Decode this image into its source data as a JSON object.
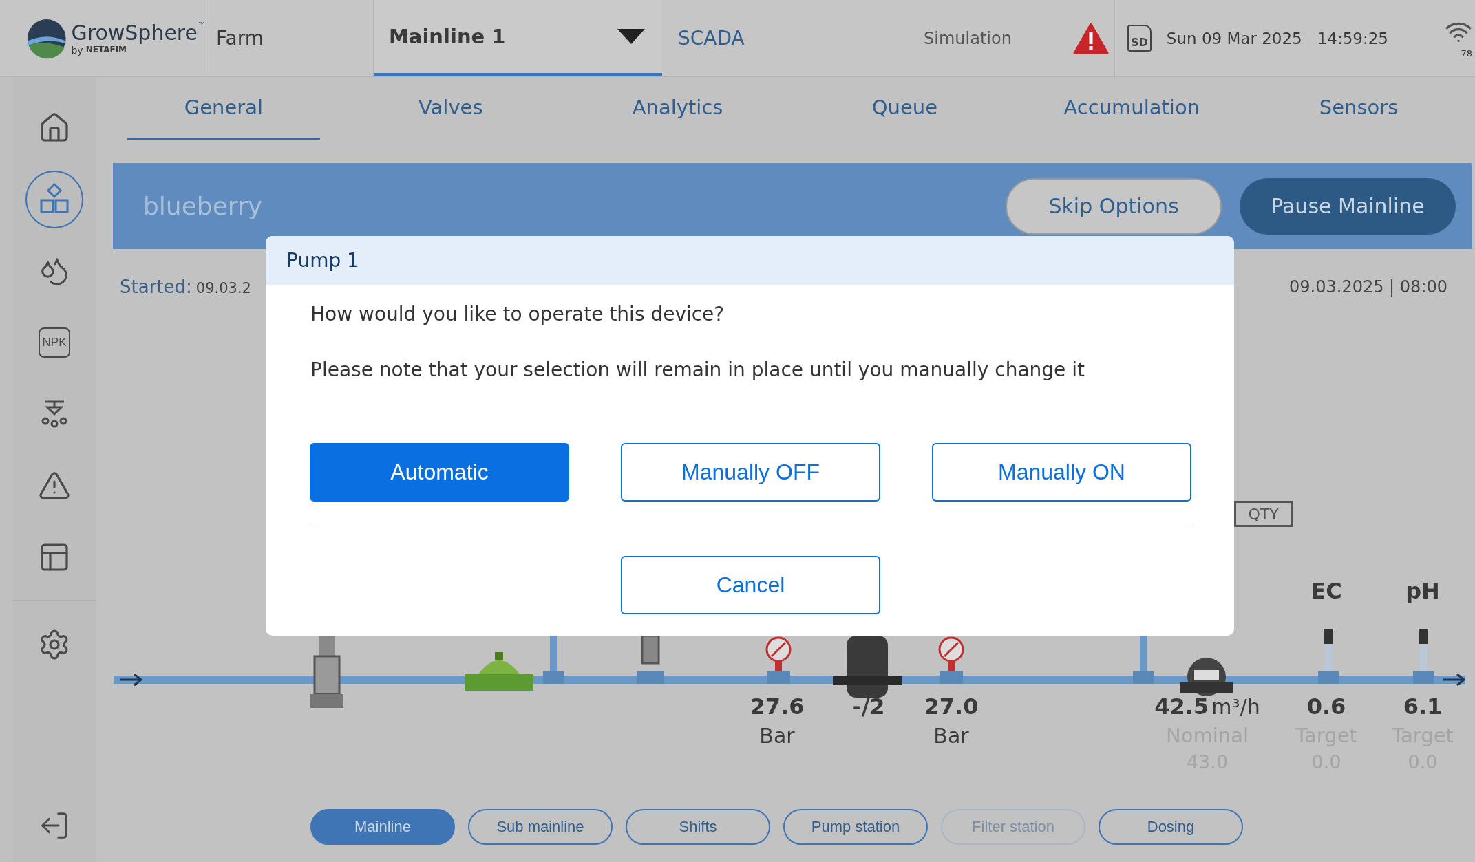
{
  "header": {
    "logo": {
      "name": "GrowSphere",
      "mark": "™",
      "by": "by",
      "brand": "NETAFIM"
    },
    "farm": "Farm",
    "mainline": "Mainline 1",
    "view": "SCADA",
    "mode": "Simulation",
    "sd": "SD",
    "date": "Sun 09 Mar 2025",
    "time": "14:59:25",
    "signal": "78"
  },
  "sidebar": {
    "items": [
      {
        "kind": "home",
        "selected": false
      },
      {
        "kind": "scada",
        "selected": true
      },
      {
        "kind": "drops",
        "selected": false
      },
      {
        "kind": "npk",
        "text": "NPK",
        "selected": false
      },
      {
        "kind": "sprinkler",
        "selected": false
      },
      {
        "kind": "alert",
        "selected": false
      },
      {
        "kind": "table",
        "selected": false
      },
      {
        "kind": "settings",
        "selected": false
      }
    ]
  },
  "tabs": [
    {
      "label": "General",
      "selected": true
    },
    {
      "label": "Valves",
      "selected": false
    },
    {
      "label": "Analytics",
      "selected": false
    },
    {
      "label": "Queue",
      "selected": false
    },
    {
      "label": "Accumulation",
      "selected": false
    },
    {
      "label": "Sensors",
      "selected": false
    }
  ],
  "banner": {
    "title": "blueberry",
    "buttons": [
      {
        "label": "Skip Options",
        "kind": "secondary"
      },
      {
        "label": "Pause Mainline",
        "kind": "primary"
      }
    ]
  },
  "started": {
    "label": "Started:",
    "value": "09.03.2",
    "end": "09.03.2025 | 08:00"
  },
  "qty": "QTY",
  "readings": [
    {
      "value": "27.6",
      "unit": "Bar"
    },
    {
      "value": "-/2"
    },
    {
      "value": "27.0",
      "unit": "Bar"
    },
    {
      "value": "42.5",
      "suffix": "m³/h",
      "sub": "Nominal",
      "sub_value": "43.0"
    },
    {
      "label": "EC",
      "value": "0.6",
      "sub": "Target",
      "sub_value": "0.0"
    },
    {
      "label": "pH",
      "value": "6.1",
      "sub": "Target",
      "sub_value": "0.0"
    }
  ],
  "bottom_tabs": [
    {
      "label": "Mainline",
      "selected": true,
      "disabled": false
    },
    {
      "label": "Sub mainline",
      "selected": false,
      "disabled": false
    },
    {
      "label": "Shifts",
      "selected": false,
      "disabled": false
    },
    {
      "label": "Pump station",
      "selected": false,
      "disabled": false
    },
    {
      "label": "Filter station",
      "selected": false,
      "disabled": true
    },
    {
      "label": "Dosing",
      "selected": false,
      "disabled": false
    }
  ],
  "dialog": {
    "title": "Pump 1",
    "question": "How would you like to operate this device?",
    "note": "Please note that your selection will remain in place until you manually change it",
    "options": [
      {
        "label": "Automatic",
        "selected": true
      },
      {
        "label": "Manually OFF",
        "selected": false
      },
      {
        "label": "Manually ON",
        "selected": false
      }
    ],
    "cancel": "Cancel"
  }
}
